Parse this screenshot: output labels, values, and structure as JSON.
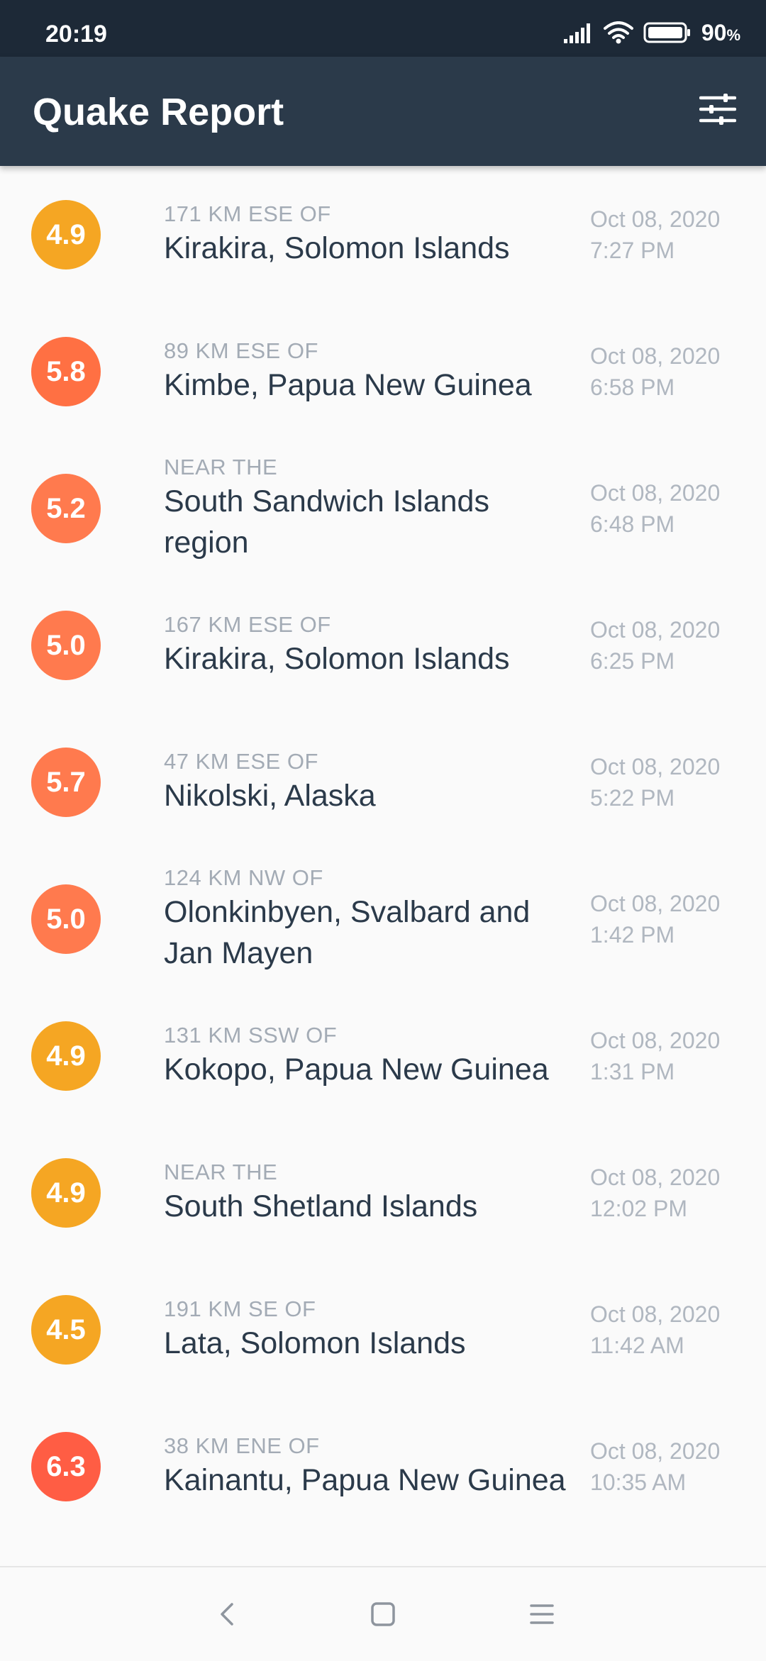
{
  "status_bar": {
    "time": "20:19",
    "battery_percent": "90",
    "battery_unit": "%",
    "icons": [
      "signal-icon",
      "wifi-icon",
      "battery-icon"
    ]
  },
  "app_bar": {
    "title": "Quake Report",
    "action_icon": "filter-sliders-icon"
  },
  "colors": {
    "status_bar": "#1d2937",
    "app_bar": "#2b3a4a",
    "background": "#fafafa",
    "primary_text": "#2b3a4a",
    "secondary_text": "#a3abb5",
    "mag_4": "#f5a623",
    "mag_5": "#ff7a4e",
    "mag_5_strong": "#ff7043",
    "mag_6": "#ff5d44"
  },
  "earthquakes": [
    {
      "magnitude": "4.9",
      "offset": "171 KM ESE OF",
      "location": "Kirakira, Solomon Islands",
      "date": "Oct 08, 2020",
      "time": "7:27 PM",
      "color": "#f5a623"
    },
    {
      "magnitude": "5.8",
      "offset": "89 KM ESE OF",
      "location": "Kimbe, Papua New Guinea",
      "date": "Oct 08, 2020",
      "time": "6:58 PM",
      "color": "#ff7043"
    },
    {
      "magnitude": "5.2",
      "offset": "NEAR THE",
      "location": "South Sandwich Islands region",
      "date": "Oct 08, 2020",
      "time": "6:48 PM",
      "color": "#ff7a4e"
    },
    {
      "magnitude": "5.0",
      "offset": "167 KM ESE OF",
      "location": "Kirakira, Solomon Islands",
      "date": "Oct 08, 2020",
      "time": "6:25 PM",
      "color": "#ff7a4e"
    },
    {
      "magnitude": "5.7",
      "offset": "47 KM ESE OF",
      "location": "Nikolski, Alaska",
      "date": "Oct 08, 2020",
      "time": "5:22 PM",
      "color": "#ff7a4e"
    },
    {
      "magnitude": "5.0",
      "offset": "124 KM NW OF",
      "location": "Olonkinbyen, Svalbard and Jan Mayen",
      "date": "Oct 08, 2020",
      "time": "1:42 PM",
      "color": "#ff7a4e"
    },
    {
      "magnitude": "4.9",
      "offset": "131 KM SSW OF",
      "location": "Kokopo, Papua New Guinea",
      "date": "Oct 08, 2020",
      "time": "1:31 PM",
      "color": "#f5a623"
    },
    {
      "magnitude": "4.9",
      "offset": "NEAR THE",
      "location": "South Shetland Islands",
      "date": "Oct 08, 2020",
      "time": "12:02 PM",
      "color": "#f5a623"
    },
    {
      "magnitude": "4.5",
      "offset": "191 KM SE OF",
      "location": "Lata, Solomon Islands",
      "date": "Oct 08, 2020",
      "time": "11:42 AM",
      "color": "#f5a623"
    },
    {
      "magnitude": "6.3",
      "offset": "38 KM ENE OF",
      "location": "Kainantu, Papua New Guinea",
      "date": "Oct 08, 2020",
      "time": "10:35 AM",
      "color": "#ff5d44"
    }
  ],
  "nav_bar": {
    "buttons": [
      "back-icon",
      "home-icon",
      "recents-icon"
    ]
  }
}
